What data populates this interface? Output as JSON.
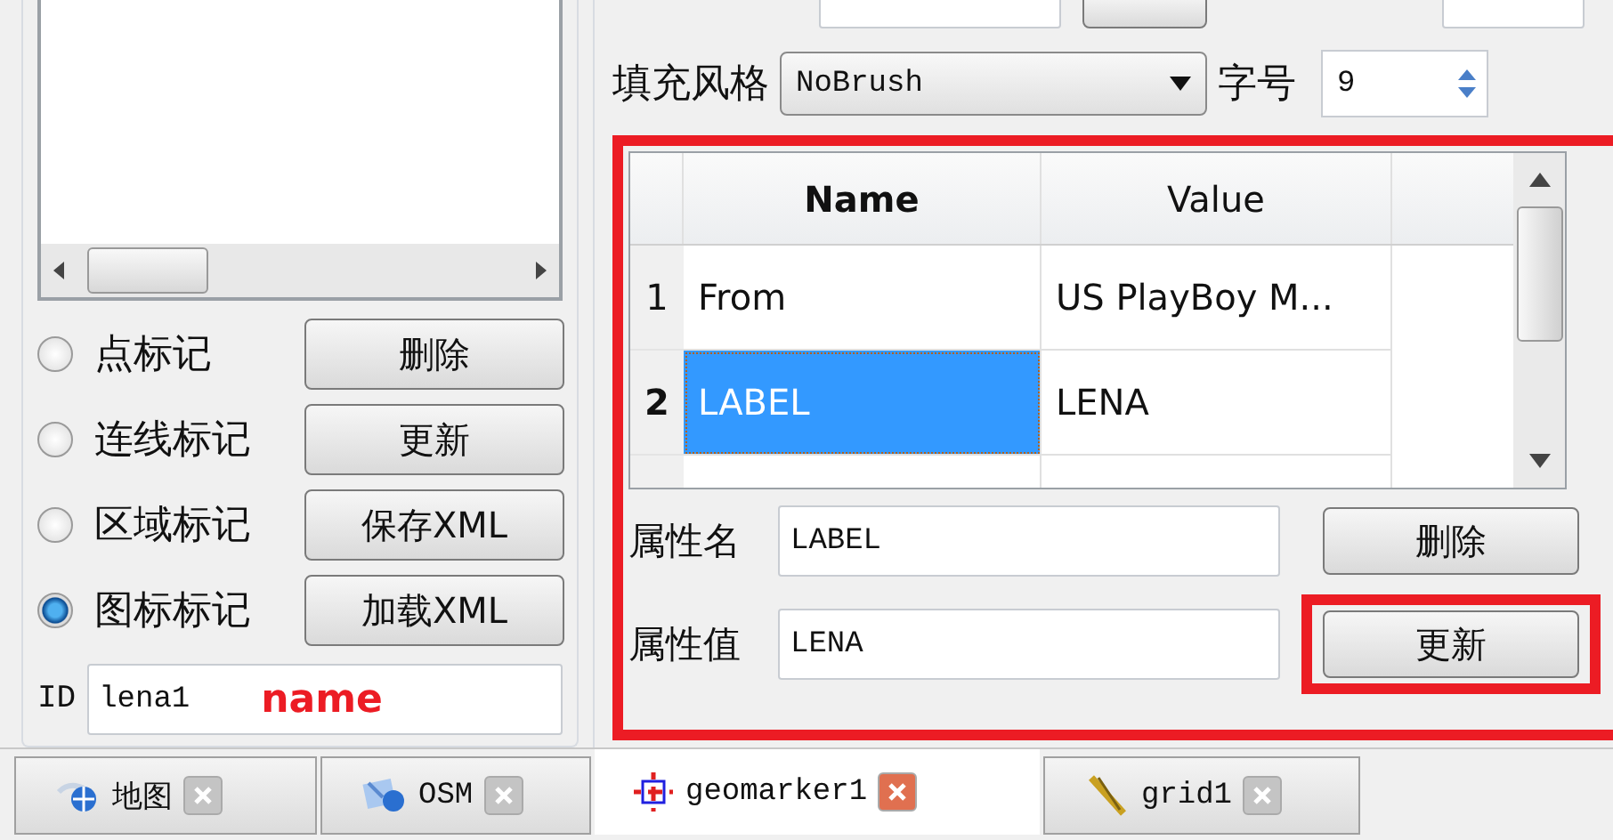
{
  "marker_types": [
    {
      "label": "点标记",
      "selected": false
    },
    {
      "label": "连线标记",
      "selected": false
    },
    {
      "label": "区域标记",
      "selected": false
    },
    {
      "label": "图标标记",
      "selected": true
    }
  ],
  "marker_buttons": [
    "删除",
    "更新",
    "保存XML",
    "加载XML"
  ],
  "id_field": {
    "label": "ID",
    "value": "lena1",
    "annotation": "name"
  },
  "fill_style": {
    "label": "填充风格",
    "value": "NoBrush"
  },
  "font_size": {
    "label": "字号",
    "value": "9"
  },
  "table": {
    "columns": [
      "Name",
      "Value"
    ],
    "rows": [
      {
        "index": "1",
        "name": "From",
        "value": "US PlayBoy M...",
        "selected": false
      },
      {
        "index": "2",
        "name": "LABEL",
        "value": "LENA",
        "selected": true
      }
    ]
  },
  "attr_name": {
    "label": "属性名",
    "value": "LABEL",
    "button": "删除"
  },
  "attr_value": {
    "label": "属性值",
    "value": "LENA",
    "button": "更新"
  },
  "tabs": [
    {
      "label": "地图",
      "kind": "globe",
      "selected": false
    },
    {
      "label": "OSM",
      "kind": "osm",
      "selected": false
    },
    {
      "label": "geomarker1",
      "kind": "marker",
      "selected": true
    },
    {
      "label": "grid1",
      "kind": "ruler",
      "selected": false
    }
  ]
}
